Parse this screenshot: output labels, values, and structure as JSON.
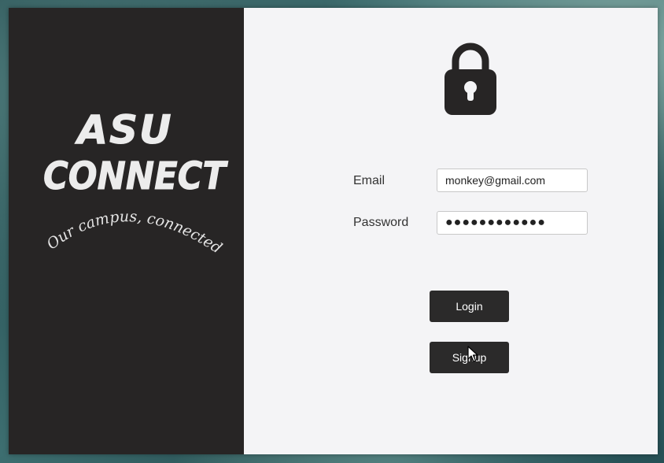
{
  "branding": {
    "title_line1": "ASU",
    "title_line2": "CONNECT",
    "tagline": "Our campus, connected"
  },
  "login_form": {
    "email_label": "Email",
    "email_value": "monkey@gmail.com",
    "password_label": "Password",
    "password_value": "●●●●●●●●●●●●",
    "login_button": "Login",
    "signup_button": "Signup"
  },
  "icons": {
    "header": "lock-icon",
    "pointer": "mouse-cursor"
  },
  "colors": {
    "left_panel": "#272525",
    "right_panel": "#f4f4f6",
    "button_bg": "#2b2a2a",
    "button_text": "#ffffff"
  }
}
